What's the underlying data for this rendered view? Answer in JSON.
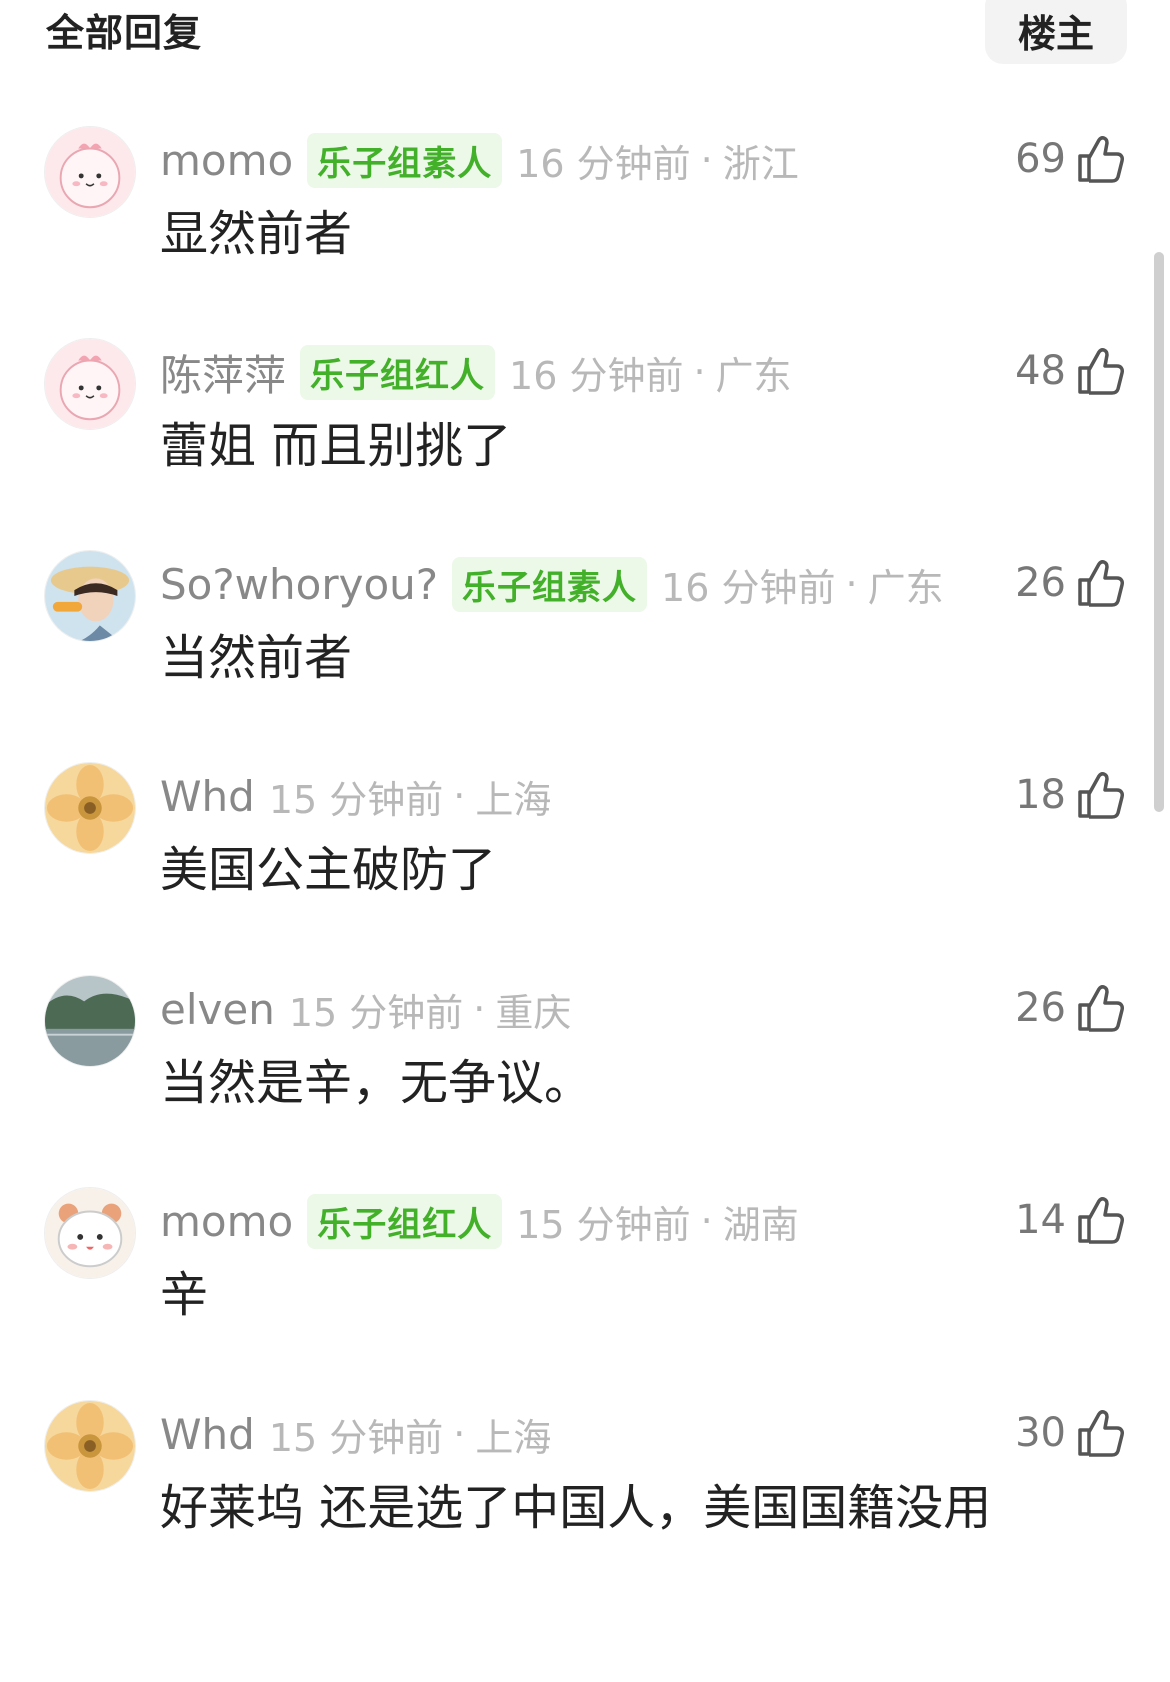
{
  "header": {
    "title": "全部回复",
    "owner_button": "楼主"
  },
  "colors": {
    "badge_bg": "#ecf8e8",
    "badge_text": "#43b02a",
    "meta_text": "#b8b8b8"
  },
  "comments": [
    {
      "username": "momo",
      "badge": "乐子组素人",
      "time": "16 分钟前",
      "dot": "·",
      "location": "浙江",
      "likes": "69",
      "text": "显然前者",
      "avatar": "pink-cartoon-avatar"
    },
    {
      "username": "陈萍萍",
      "badge": "乐子组红人",
      "time": "16 分钟前",
      "dot": "·",
      "location": "广东",
      "likes": "48",
      "text": "蕾姐 而且别挑了",
      "avatar": "pink-cartoon-avatar"
    },
    {
      "username": "So?whoryou?",
      "badge": "乐子组素人",
      "time": "16 分钟前",
      "dot": "·",
      "location": "广东",
      "likes": "26",
      "text": "当然前者",
      "avatar": "sunhat-person-avatar"
    },
    {
      "username": "Whd",
      "badge": "",
      "time": "15 分钟前",
      "dot": "·",
      "location": "上海",
      "likes": "18",
      "text": "美国公主破防了",
      "avatar": "flower-avatar"
    },
    {
      "username": "elven",
      "badge": "",
      "time": "15 分钟前",
      "dot": "·",
      "location": "重庆",
      "likes": "26",
      "text": "当然是辛，无争议。",
      "avatar": "river-landscape-avatar"
    },
    {
      "username": "momo",
      "badge": "乐子组红人",
      "time": "15 分钟前",
      "dot": "·",
      "location": "湖南",
      "likes": "14",
      "text": "辛",
      "avatar": "hamster-cartoon-avatar"
    },
    {
      "username": "Whd",
      "badge": "",
      "time": "15 分钟前",
      "dot": "·",
      "location": "上海",
      "likes": "30",
      "text": "好莱坞 还是选了中国人，美国国籍没用",
      "avatar": "flower-avatar"
    }
  ]
}
